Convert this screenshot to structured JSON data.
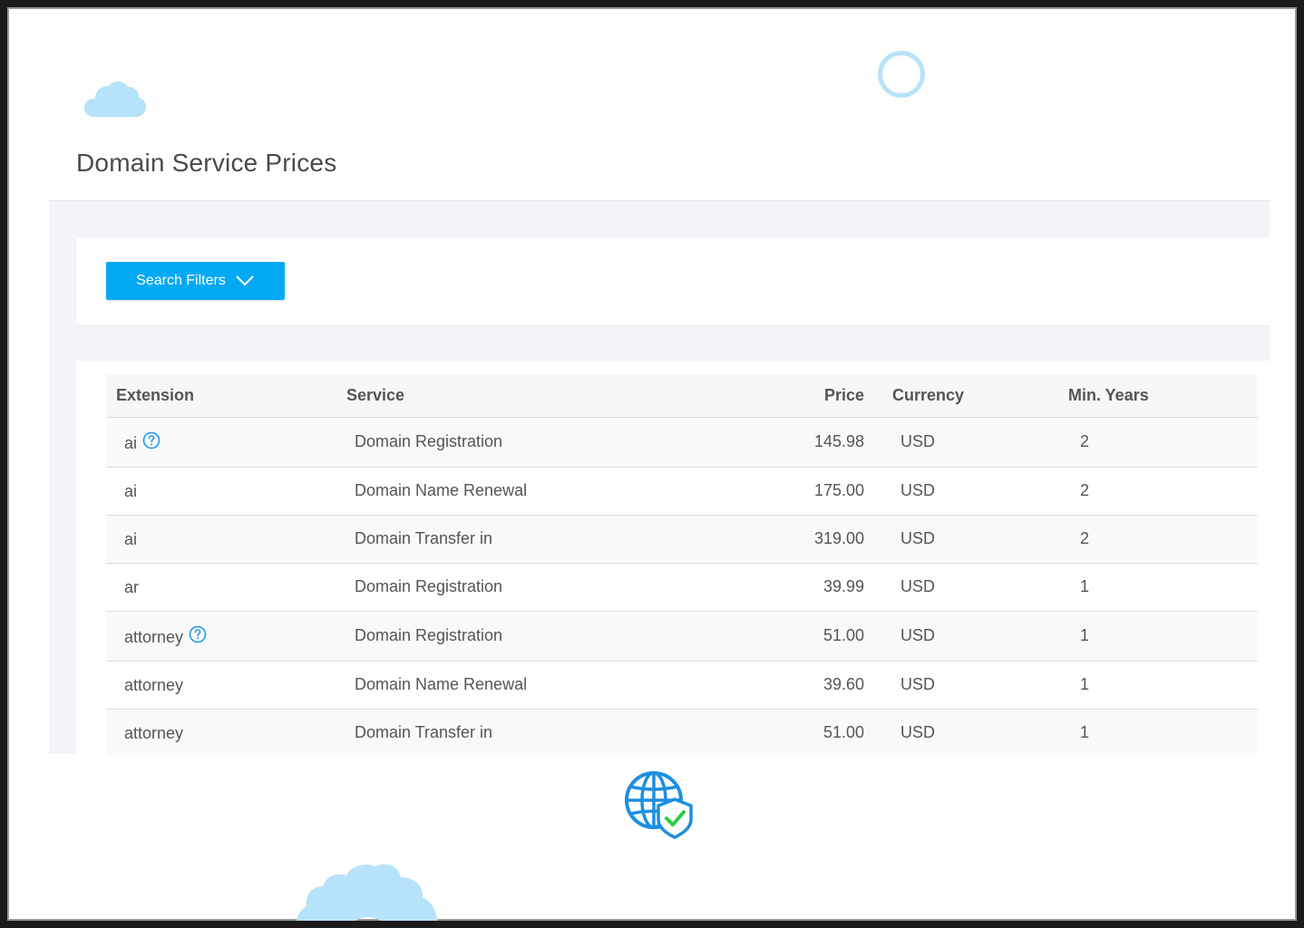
{
  "page": {
    "title": "Domain Service Prices"
  },
  "filters": {
    "button_label": "Search Filters"
  },
  "table": {
    "columns": {
      "extension": "Extension",
      "service": "Service",
      "price": "Price",
      "currency": "Currency",
      "min_years": "Min. Years"
    },
    "rows": [
      {
        "extension": "ai",
        "help": true,
        "service": "Domain Registration",
        "price": "145.98",
        "currency": "USD",
        "min_years": "2"
      },
      {
        "extension": "ai",
        "help": false,
        "service": "Domain Name Renewal",
        "price": "175.00",
        "currency": "USD",
        "min_years": "2"
      },
      {
        "extension": "ai",
        "help": false,
        "service": "Domain Transfer in",
        "price": "319.00",
        "currency": "USD",
        "min_years": "2"
      },
      {
        "extension": "ar",
        "help": false,
        "service": "Domain Registration",
        "price": "39.99",
        "currency": "USD",
        "min_years": "1"
      },
      {
        "extension": "attorney",
        "help": true,
        "service": "Domain Registration",
        "price": "51.00",
        "currency": "USD",
        "min_years": "1"
      },
      {
        "extension": "attorney",
        "help": false,
        "service": "Domain Name Renewal",
        "price": "39.60",
        "currency": "USD",
        "min_years": "1"
      },
      {
        "extension": "attorney",
        "help": false,
        "service": "Domain Transfer in",
        "price": "51.00",
        "currency": "USD",
        "min_years": "1"
      }
    ]
  },
  "colors": {
    "accent": "#03a9f4",
    "decoration": "#b6e3fb"
  },
  "icons": {
    "help": "question-circle-icon",
    "filter_toggle": "chevron-down-icon",
    "decor_cloud": "cloud-icon",
    "decor_ring": "ring-icon",
    "decor_gear": "gear-icon",
    "domain_secure": "globe-shield-icon"
  }
}
